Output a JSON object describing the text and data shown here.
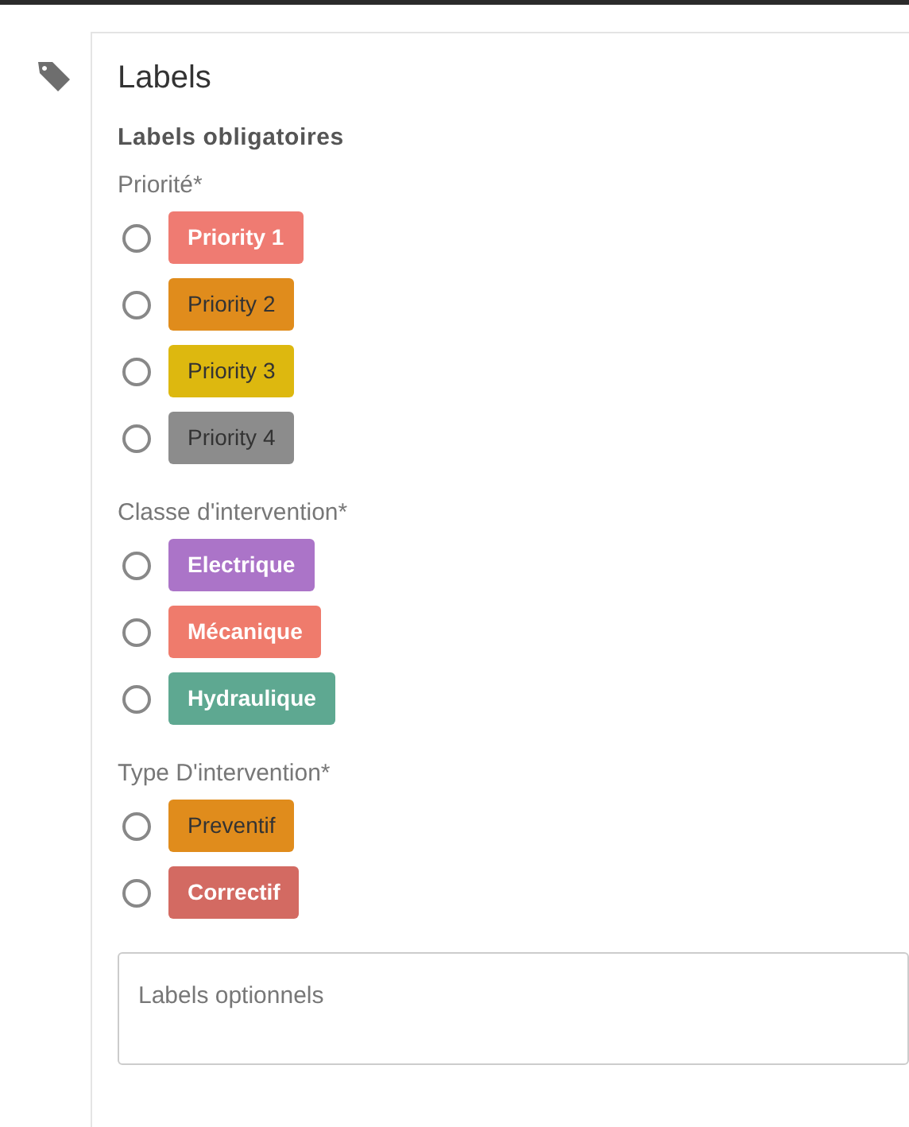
{
  "panel": {
    "title": "Labels"
  },
  "section_title": "Labels obligatoires",
  "groups": [
    {
      "label": "Priorité*",
      "options": [
        {
          "label": "Priority 1",
          "color": "#ef7b72",
          "selected": false
        },
        {
          "label": "Priority 2",
          "color": "#e08c1c",
          "selected": false
        },
        {
          "label": "Priority 3",
          "color": "#ddb80f",
          "selected": false
        },
        {
          "label": "Priority 4",
          "color": "#8c8c8c",
          "selected": false
        }
      ]
    },
    {
      "label": "Classe d'intervention*",
      "options": [
        {
          "label": "Electrique",
          "color": "#ab74c8",
          "selected": false
        },
        {
          "label": "Mécanique",
          "color": "#ef7b6c",
          "selected": false
        },
        {
          "label": "Hydraulique",
          "color": "#5ea891",
          "selected": false
        }
      ]
    },
    {
      "label": "Type D'intervention*",
      "options": [
        {
          "label": "Preventif",
          "color": "#e08c1c",
          "selected": false
        },
        {
          "label": "Correctif",
          "color": "#d36a62",
          "selected": false
        }
      ]
    }
  ],
  "optional_field": {
    "placeholder": "Labels optionnels"
  }
}
